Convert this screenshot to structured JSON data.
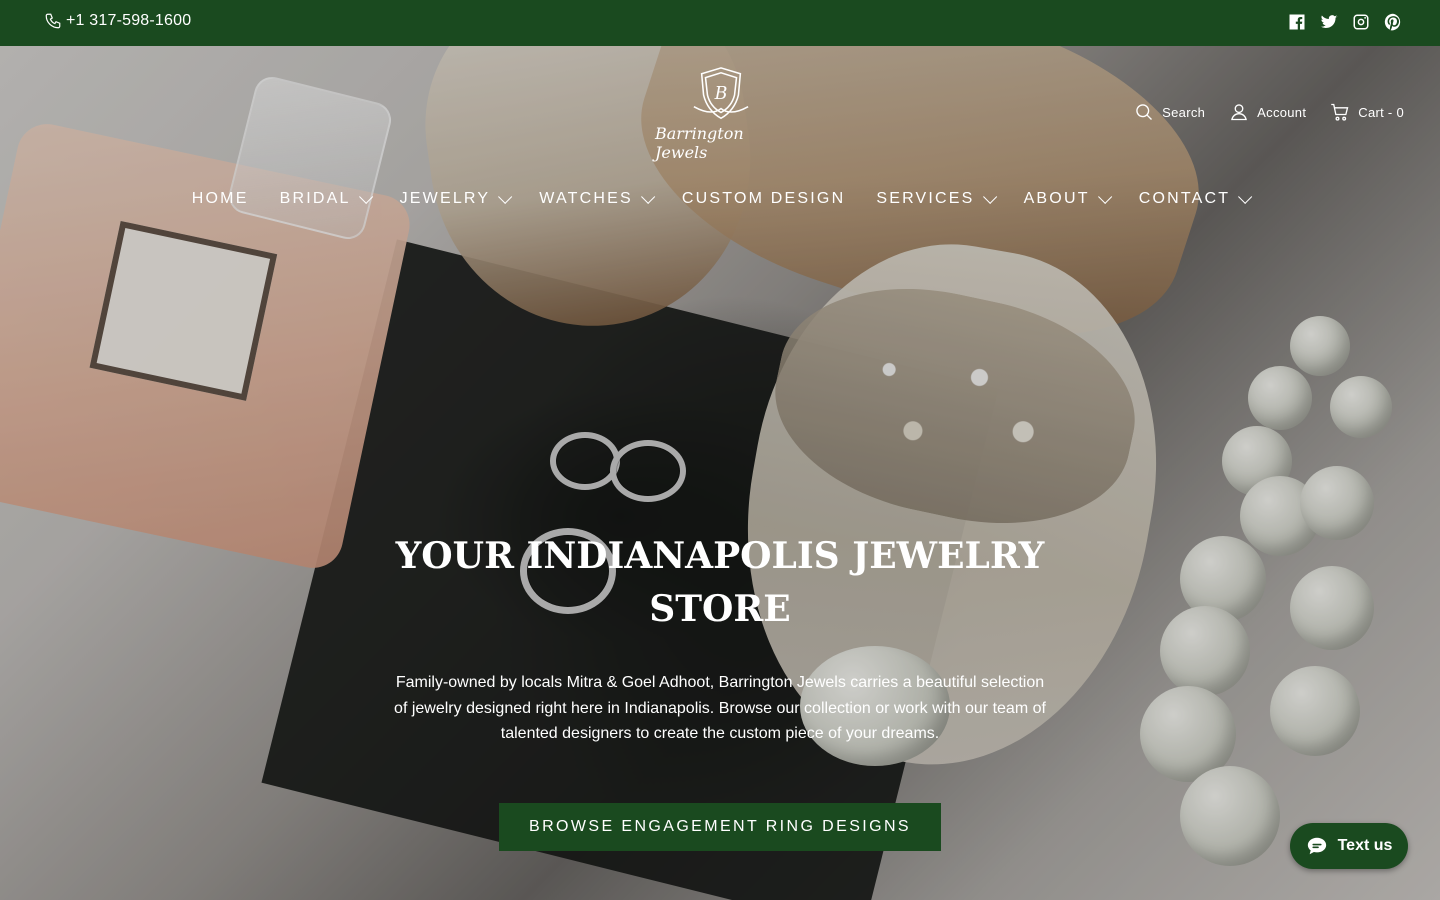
{
  "topbar": {
    "phone": "+1 317-598-1600",
    "social": [
      "facebook-icon",
      "twitter-icon",
      "instagram-icon",
      "pinterest-icon"
    ]
  },
  "header": {
    "logo_text": "Barrington Jewels",
    "utils": {
      "search": "Search",
      "account": "Account",
      "cart": "Cart - 0"
    }
  },
  "nav": [
    {
      "label": "HOME",
      "dropdown": false
    },
    {
      "label": "BRIDAL",
      "dropdown": true
    },
    {
      "label": "JEWELRY",
      "dropdown": true
    },
    {
      "label": "WATCHES",
      "dropdown": true
    },
    {
      "label": "CUSTOM DESIGN",
      "dropdown": false
    },
    {
      "label": "SERVICES",
      "dropdown": true
    },
    {
      "label": "ABOUT",
      "dropdown": true
    },
    {
      "label": "CONTACT",
      "dropdown": true
    }
  ],
  "hero": {
    "headline": "YOUR INDIANAPOLIS JEWELRY STORE",
    "subtext": "Family-owned by locals Mitra & Goel Adhoot, Barrington Jewels carries a beautiful selection of jewelry designed right here in Indianapolis. Browse our collection or work with our team of talented designers to create the custom piece of your dreams.",
    "cta": "BROWSE ENGAGEMENT RING DESIGNS"
  },
  "chat_widget": {
    "label": "Text us"
  },
  "colors": {
    "brand_green": "#1a4a1f",
    "text_light": "#ffffff"
  }
}
